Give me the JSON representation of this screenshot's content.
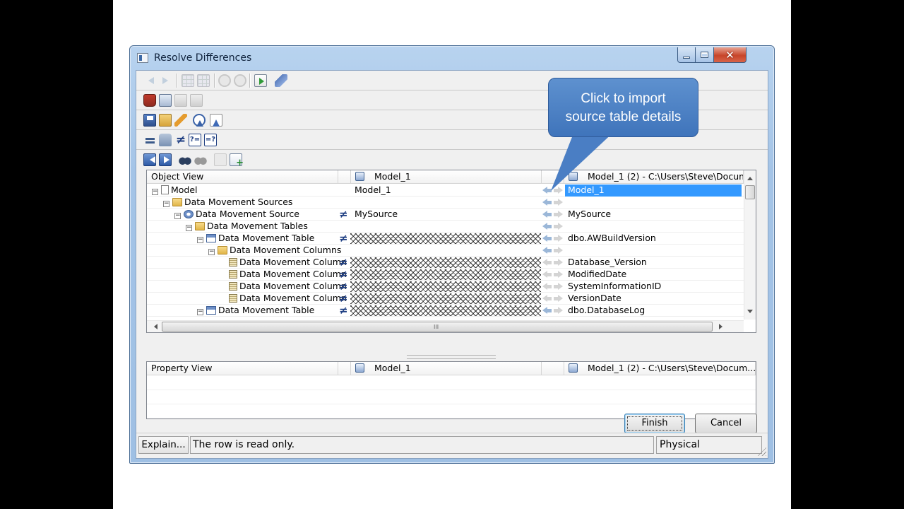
{
  "window": {
    "title": "Resolve Differences"
  },
  "callout": {
    "line1": "Click to import",
    "line2": "source table details"
  },
  "tree": {
    "col_object_view": "Object View",
    "col_left_model": "Model_1",
    "col_right_model": "Model_1 (2) - C:\\Users\\Steve\\Docum.",
    "rows": [
      {
        "label": "Model",
        "left": "Model_1",
        "right": "Model_1"
      },
      {
        "label": "Data Movement Sources",
        "left": "",
        "right": ""
      },
      {
        "label": "Data Movement Source",
        "left": "MySource",
        "right": "MySource"
      },
      {
        "label": "Data Movement Tables",
        "left": "",
        "right": ""
      },
      {
        "label": "Data Movement Table",
        "left": "",
        "right": "dbo.AWBuildVersion"
      },
      {
        "label": "Data Movement Columns",
        "left": "",
        "right": ""
      },
      {
        "label": "Data Movement Column",
        "left": "",
        "right": "Database_Version"
      },
      {
        "label": "Data Movement Column",
        "left": "",
        "right": "ModifiedDate"
      },
      {
        "label": "Data Movement Column",
        "left": "",
        "right": "SystemInformationID"
      },
      {
        "label": "Data Movement Column",
        "left": "",
        "right": "VersionDate"
      },
      {
        "label": "Data Movement Table",
        "left": "",
        "right": "dbo.DatabaseLog"
      }
    ],
    "hscroll_grip": "III"
  },
  "property": {
    "col_property_view": "Property View",
    "col_left_model": "Model_1",
    "col_right_model": "Model_1 (2) - C:\\Users\\Steve\\Docum..."
  },
  "buttons": {
    "finish": "Finish",
    "cancel": "Cancel"
  },
  "status": {
    "explain": "Explain...",
    "message": "The row is read only.",
    "mode": "Physical"
  },
  "icons": {
    "toolbar1": [
      "back-arrow-icon",
      "forward-arrow-icon",
      "grid-icon",
      "grid-icon",
      "undo-circle-icon",
      "redo-circle-icon",
      "import-document-icon",
      "tag-icon"
    ],
    "toolbar2": [
      "database-red-icon",
      "database-blue-icon",
      "database-grey-icon",
      "database-grey-icon"
    ],
    "toolbar3": [
      "save-icon",
      "open-icon",
      "pencil-icon",
      "warning-circle-icon",
      "triangle-icon"
    ],
    "toolbar4": [
      "equal-icon",
      "hand-icon",
      "not-equal-icon",
      "question-box-icon",
      "question-box-icon"
    ],
    "toolbar5": [
      "previous-icon",
      "next-icon",
      "binoculars-icon",
      "binoculars-icon",
      "document-icon",
      "add-document-icon"
    ]
  }
}
